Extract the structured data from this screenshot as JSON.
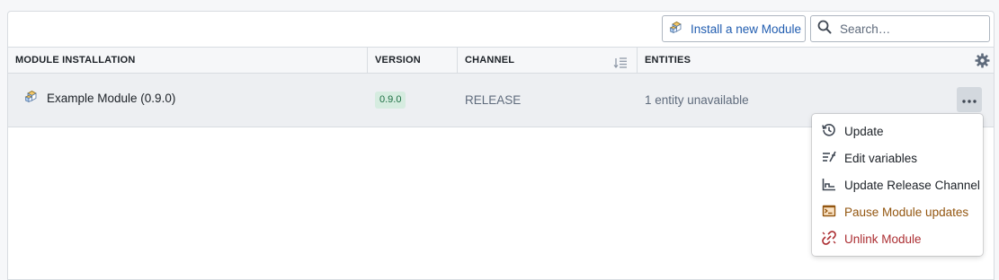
{
  "toolbar": {
    "install_label": "Install a new Module",
    "search_placeholder": "Search…"
  },
  "table": {
    "columns": [
      "MODULE INSTALLATION",
      "VERSION",
      "CHANNEL",
      "ENTITIES"
    ],
    "rows": [
      {
        "name": "Example Module (0.9.0)",
        "version": "0.9.0",
        "channel": "RELEASE",
        "entities": "1 entity unavailable"
      }
    ]
  },
  "menu": {
    "items": [
      {
        "label": "Update",
        "icon": "history-icon"
      },
      {
        "label": "Edit variables",
        "icon": "variable-icon"
      },
      {
        "label": "Update Release Channel",
        "icon": "step-chart-icon"
      },
      {
        "label": "Pause Module updates",
        "icon": "console-icon"
      },
      {
        "label": "Unlink Module",
        "icon": "unlink-icon"
      }
    ]
  },
  "colors": {
    "accent": "#215db0",
    "warning": "#935610",
    "danger": "#ac2f33",
    "version_tag_bg": "#d6ece0",
    "version_tag_text": "#1c6e42"
  }
}
